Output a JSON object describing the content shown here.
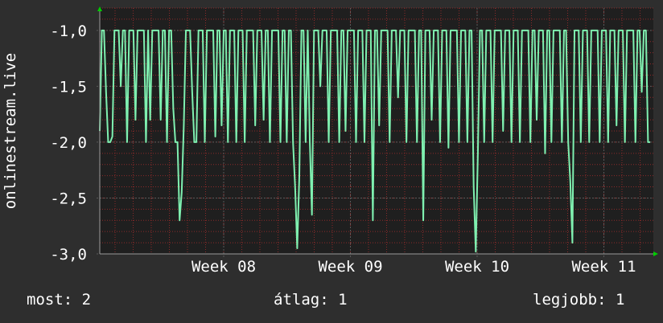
{
  "chart_data": {
    "type": "line",
    "ylabel": "onlinestream.live",
    "ylim": [
      -3.0,
      -0.8
    ],
    "y_ticks": [
      -1.0,
      -1.5,
      -2.0,
      -2.5,
      -3.0
    ],
    "y_tick_labels": [
      "-1,0",
      "-1,5",
      "-2,0",
      "-2,5",
      "-3,0"
    ],
    "x_ticks": [
      "Week 08",
      "Week 09",
      "Week 10",
      "Week 11"
    ],
    "grid": true,
    "colors": {
      "background": "#2e2e2e",
      "plot": "#1f1f1f",
      "line": "#7ff0b0",
      "minor_grid": "#8c2a2a",
      "major_grid": "#5a5a5a",
      "axis_arrow": "#00cc00"
    },
    "series": [
      {
        "values": [
          -1.9,
          -1.0,
          -1.0,
          -1.55,
          -2.0,
          -2.0,
          -1.95,
          -1.0,
          -1.0,
          -1.0,
          -1.5,
          -1.0,
          -1.0,
          -2.0,
          -1.0,
          -1.0,
          -1.0,
          -1.8,
          -1.0,
          -1.0,
          -1.0,
          -1.0,
          -2.0,
          -1.0,
          -1.8,
          -1.0,
          -1.0,
          -1.0,
          -1.0,
          -1.8,
          -1.0,
          -1.0,
          -2.0,
          -1.0,
          -1.0,
          -1.7,
          -2.0,
          -2.0,
          -2.7,
          -2.45,
          -1.85,
          -1.0,
          -1.0,
          -1.0,
          -1.55,
          -2.0,
          -2.0,
          -1.0,
          -1.0,
          -1.0,
          -2.0,
          -1.0,
          -1.0,
          -1.0,
          -1.0,
          -1.95,
          -1.0,
          -1.0,
          -1.85,
          -1.0,
          -1.0,
          -2.0,
          -1.0,
          -1.0,
          -1.0,
          -2.0,
          -1.0,
          -1.0,
          -1.0,
          -2.0,
          -1.0,
          -1.0,
          -1.0,
          -1.0,
          -1.85,
          -1.0,
          -1.0,
          -1.0,
          -1.8,
          -1.0,
          -1.0,
          -2.0,
          -1.0,
          -1.0,
          -1.0,
          -1.0,
          -2.0,
          -1.0,
          -1.0,
          -2.0,
          -1.0,
          -1.0,
          -2.0,
          -2.4,
          -2.95,
          -2.3,
          -1.0,
          -1.0,
          -2.0,
          -1.0,
          -2.0,
          -2.65,
          -1.0,
          -1.0,
          -1.0,
          -1.5,
          -1.0,
          -1.0,
          -1.0,
          -2.0,
          -1.0,
          -1.0,
          -1.0,
          -1.0,
          -2.0,
          -1.0,
          -1.0,
          -1.9,
          -1.0,
          -1.0,
          -1.0,
          -1.0,
          -2.0,
          -1.0,
          -1.0,
          -1.0,
          -2.0,
          -1.0,
          -1.0,
          -1.0,
          -2.7,
          -1.0,
          -1.0,
          -1.85,
          -1.0,
          -1.0,
          -1.0,
          -1.0,
          -2.0,
          -1.0,
          -1.0,
          -1.0,
          -1.6,
          -1.0,
          -1.0,
          -1.0,
          -2.0,
          -1.0,
          -1.0,
          -1.0,
          -1.0,
          -2.0,
          -1.0,
          -1.0,
          -2.7,
          -1.0,
          -1.0,
          -1.0,
          -1.8,
          -1.0,
          -1.0,
          -1.0,
          -2.0,
          -1.0,
          -1.0,
          -1.0,
          -2.05,
          -1.0,
          -1.0,
          -1.0,
          -1.0,
          -2.0,
          -1.0,
          -1.0,
          -1.0,
          -2.0,
          -1.0,
          -1.0,
          -2.4,
          -2.98,
          -2.1,
          -1.0,
          -1.0,
          -2.0,
          -1.0,
          -1.0,
          -1.0,
          -2.0,
          -1.0,
          -1.0,
          -1.0,
          -1.0,
          -1.9,
          -1.0,
          -1.0,
          -1.0,
          -2.0,
          -1.0,
          -1.0,
          -1.0,
          -2.0,
          -1.0,
          -1.0,
          -1.0,
          -1.0,
          -2.0,
          -1.0,
          -1.0,
          -1.8,
          -1.0,
          -1.0,
          -1.0,
          -2.1,
          -1.0,
          -1.0,
          -2.0,
          -1.0,
          -1.0,
          -1.0,
          -1.0,
          -2.0,
          -1.0,
          -1.0,
          -2.0,
          -2.35,
          -2.9,
          -1.0,
          -1.0,
          -1.0,
          -2.0,
          -1.0,
          -1.0,
          -1.0,
          -2.0,
          -1.0,
          -1.0,
          -1.0,
          -1.0,
          -2.0,
          -1.0,
          -1.0,
          -1.0,
          -2.0,
          -1.0,
          -1.0,
          -1.0,
          -1.85,
          -1.0,
          -1.0,
          -1.0,
          -2.0,
          -1.0,
          -1.0,
          -1.0,
          -1.0,
          -2.0,
          -1.0,
          -1.0,
          -1.55,
          -1.0,
          -1.0,
          -2.0,
          -2.0
        ]
      }
    ]
  },
  "footer": {
    "current": "most: 2",
    "average": "átlag: 1",
    "best": "legjobb: 1"
  }
}
